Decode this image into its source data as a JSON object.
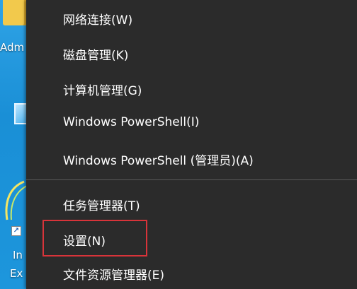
{
  "desktop": {
    "icons": [
      {
        "label": "Adm",
        "icon": "folder-icon"
      },
      {
        "label": "",
        "icon": "monitor-icon"
      },
      {
        "label_line1": "In",
        "label_line2": "Ex",
        "icon": "browser-icon"
      }
    ]
  },
  "menu": {
    "items": [
      {
        "label": "网络连接(W)"
      },
      {
        "label": "磁盘管理(K)"
      },
      {
        "label": "计算机管理(G)"
      },
      {
        "label": "Windows PowerShell(I)"
      },
      {
        "label": "Windows PowerShell (管理员)(A)"
      },
      {
        "label": "任务管理器(T)"
      },
      {
        "label": "设置(N)"
      },
      {
        "label": "文件资源管理器(E)"
      }
    ],
    "highlighted_index": 6
  },
  "colors": {
    "menu_background": "#2b2b2b",
    "menu_text": "#ffffff",
    "separator": "#5a5a5a",
    "highlight_border": "#d8343a",
    "desktop": "#1a8fd6"
  }
}
